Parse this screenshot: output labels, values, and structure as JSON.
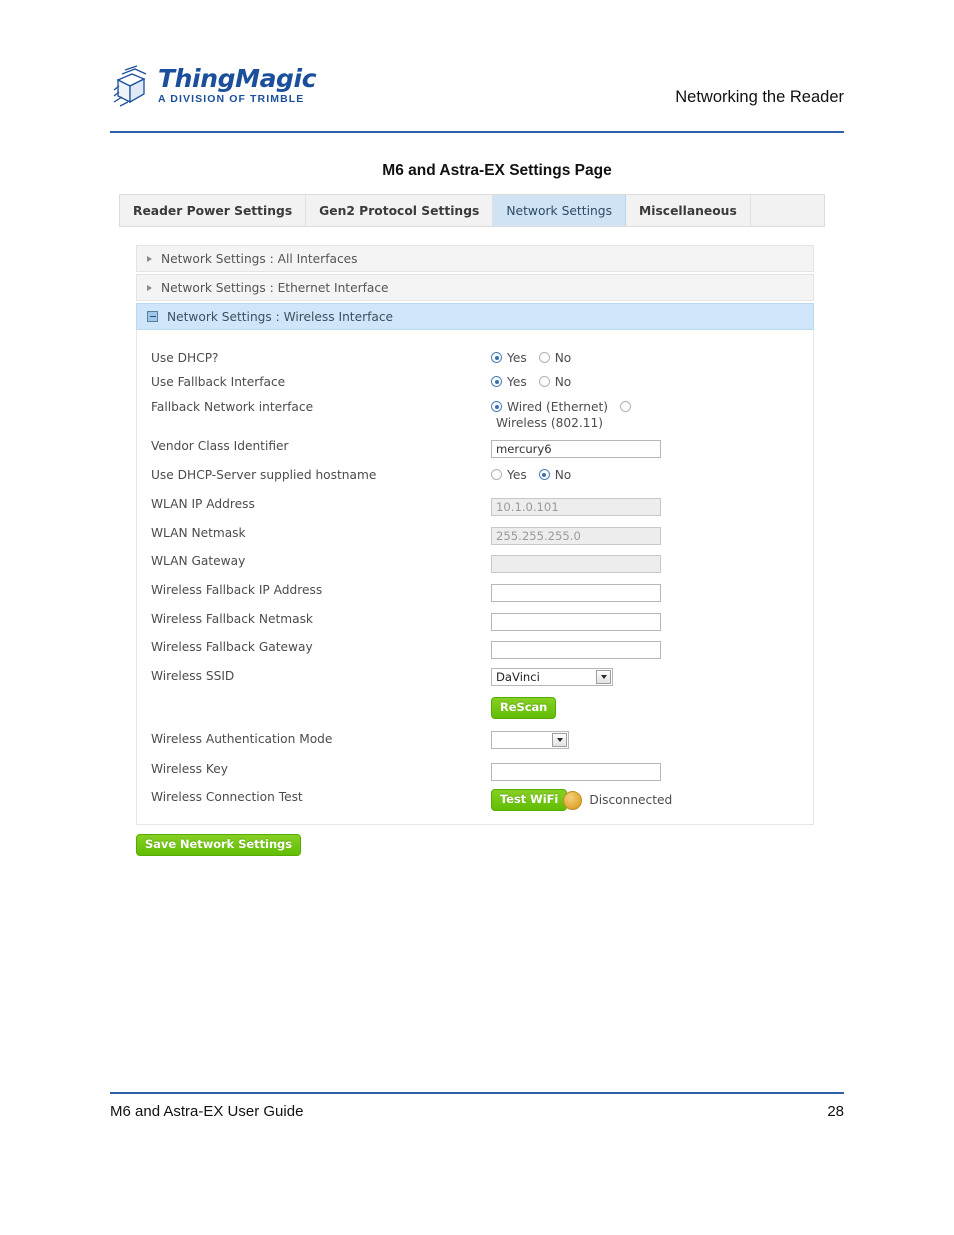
{
  "document": {
    "header_right": "Networking the Reader",
    "logo": {
      "word": "ThingMagic",
      "tagline": "A DIVISION OF TRIMBLE"
    },
    "figure_title": "M6 and Astra-EX Settings Page",
    "footer_left": "M6 and Astra-EX User Guide",
    "footer_page": "28"
  },
  "colors": {
    "brand_blue": "#1b4f9c",
    "rule_blue": "#2f5fa8",
    "tab_active_bg": "#cfe3f5",
    "accordion_active_bg": "#cfe6fa",
    "button_green": "#6ec814",
    "status_amber": "#dfa62f"
  },
  "app": {
    "tabs": [
      {
        "label": "Reader Power Settings",
        "active": false
      },
      {
        "label": "Gen2 Protocol Settings",
        "active": false
      },
      {
        "label": "Network Settings",
        "active": true
      },
      {
        "label": "Miscellaneous",
        "active": false
      }
    ],
    "accordions": [
      {
        "label": "Network Settings : All Interfaces",
        "state": "collapsed"
      },
      {
        "label": "Network Settings : Ethernet Interface",
        "state": "collapsed"
      },
      {
        "label": "Network Settings : Wireless Interface",
        "state": "expanded"
      }
    ],
    "fields": {
      "use_dhcp": {
        "label": "Use DHCP?",
        "yes": "Yes",
        "no": "No",
        "selected": "Yes"
      },
      "use_fallback": {
        "label": "Use Fallback Interface",
        "yes": "Yes",
        "no": "No",
        "selected": "Yes"
      },
      "fallback_interface": {
        "label": "Fallback Network interface",
        "option_wired": "Wired (Ethernet)",
        "option_wireless": "Wireless (802.11)",
        "selected": "Wired (Ethernet)"
      },
      "vendor_class": {
        "label": "Vendor Class Identifier",
        "value": "mercury6",
        "disabled": false
      },
      "dhcp_hostname": {
        "label": "Use DHCP-Server supplied hostname",
        "yes": "Yes",
        "no": "No",
        "selected": "No"
      },
      "wlan_ip": {
        "label": "WLAN IP Address",
        "value": "10.1.0.101",
        "disabled": true
      },
      "wlan_netmask": {
        "label": "WLAN Netmask",
        "value": "255.255.255.0",
        "disabled": true
      },
      "wlan_gateway": {
        "label": "WLAN Gateway",
        "value": "",
        "disabled": true
      },
      "fallback_ip": {
        "label": "Wireless Fallback IP Address",
        "value": "",
        "disabled": false
      },
      "fallback_netmask": {
        "label": "Wireless Fallback Netmask",
        "value": "",
        "disabled": false
      },
      "fallback_gateway": {
        "label": "Wireless Fallback Gateway",
        "value": "",
        "disabled": false
      },
      "wireless_ssid": {
        "label": "Wireless SSID",
        "value": "DaVinci"
      },
      "rescan_button": "ReScan",
      "auth_mode": {
        "label": "Wireless Authentication Mode",
        "value": ""
      },
      "wireless_key": {
        "label": "Wireless Key",
        "value": ""
      },
      "connection_test": {
        "label": "Wireless Connection Test",
        "button": "Test WiFi",
        "status": "Disconnected"
      }
    },
    "save_button": "Save Network Settings"
  }
}
